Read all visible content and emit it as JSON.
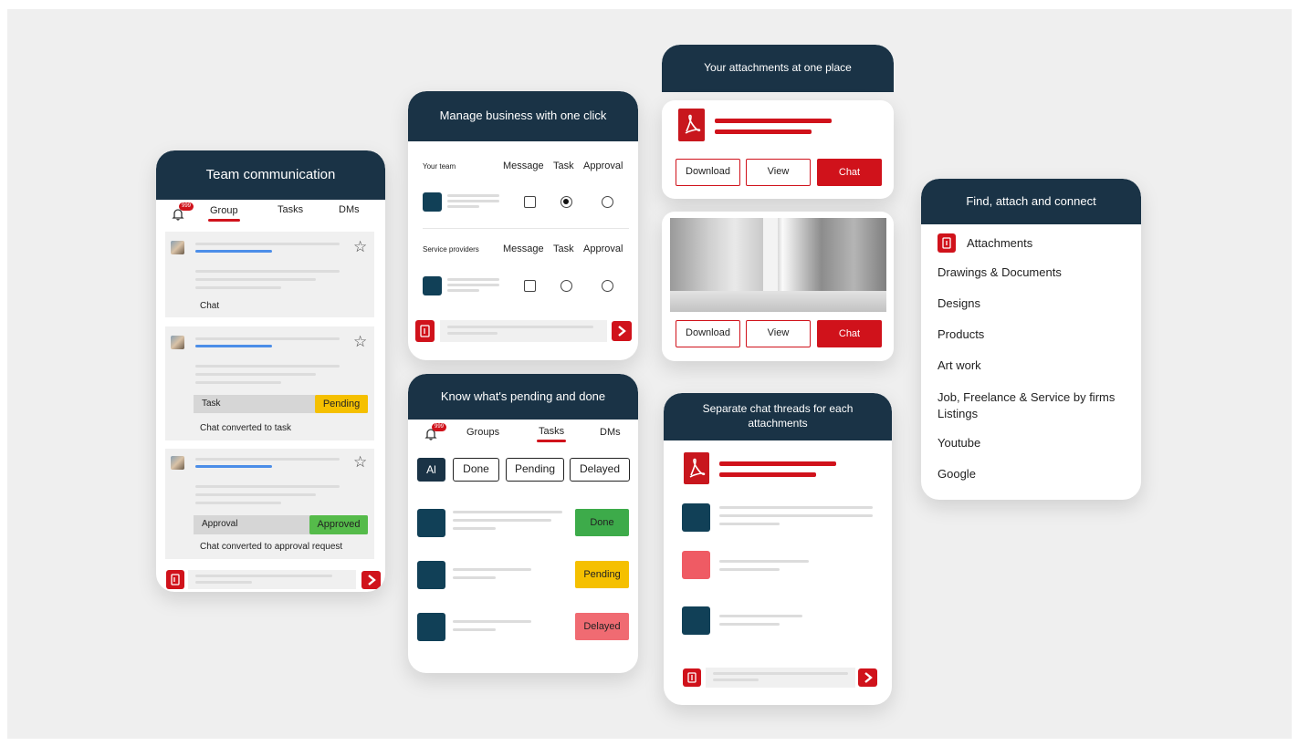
{
  "card1": {
    "title": "Team communication",
    "badge": "999",
    "tabs": [
      "Group",
      "Tasks",
      "DMs"
    ],
    "messages": [
      {
        "footer": "Chat"
      },
      {
        "task_label": "Task",
        "status": "Pending",
        "footer": "Chat converted to task"
      },
      {
        "task_label": "Approval",
        "status": "Approved",
        "footer": "Chat converted to approval request"
      }
    ]
  },
  "card2": {
    "title": "Manage business with one click",
    "sections": [
      {
        "label": "Your team",
        "cols": [
          "Message",
          "Task",
          "Approval"
        ]
      },
      {
        "label": "Service providers",
        "cols": [
          "Message",
          "Task",
          "Approval"
        ]
      }
    ]
  },
  "card3": {
    "title": "Your attachments at one place",
    "buttons": [
      "Download",
      "View",
      "Chat"
    ],
    "buttons2": [
      "Download",
      "View",
      "Chat"
    ]
  },
  "card4": {
    "title": "Know what's pending and done",
    "badge": "999",
    "tabs": [
      "Groups",
      "Tasks",
      "DMs"
    ],
    "filters": [
      "Al",
      "Done",
      "Pending",
      "Delayed"
    ],
    "statuses": [
      "Done",
      "Pending",
      "Delayed"
    ]
  },
  "card5": {
    "title": "Separate chat threads for each attachments"
  },
  "card6": {
    "title": "Find, attach and connect",
    "heading": "Attachments",
    "items": [
      "Drawings & Documents",
      "Designs",
      "Products",
      "Art work",
      "Job, Freelance & Service by firms Listings",
      "Youtube",
      "Google"
    ]
  },
  "colors": {
    "navy": "#1a3346",
    "red": "#d0121b",
    "pending": "#f5c000",
    "done": "#3dab4a",
    "approved": "#55bb4a",
    "delayed": "#f06b72"
  }
}
